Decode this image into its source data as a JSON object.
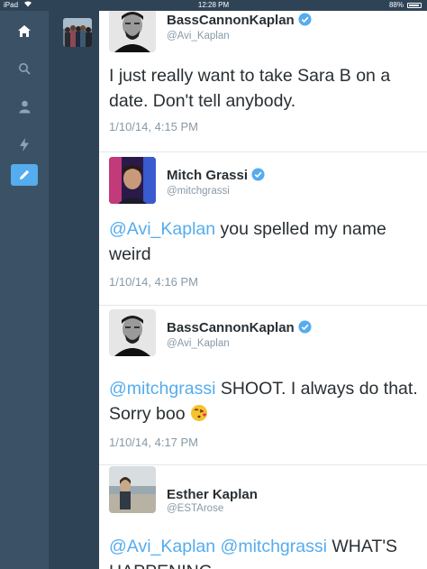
{
  "status_bar": {
    "carrier": "iPad",
    "time": "12:28 PM",
    "battery": "88%",
    "battery_level": 0.88
  },
  "nav": {
    "items": [
      {
        "icon": "home-icon",
        "active": false
      },
      {
        "icon": "search-icon",
        "active": false
      },
      {
        "icon": "profile-icon",
        "active": false
      },
      {
        "icon": "activity-icon",
        "active": false
      },
      {
        "icon": "compose-icon",
        "active": true
      }
    ]
  },
  "tweets": [
    {
      "name": "BassCannonKaplan",
      "handle": "@Avi_Kaplan",
      "verified": true,
      "text_segments": [
        {
          "text": "I just really want to take Sara B on a date. Don't tell anybody.",
          "mention": false
        }
      ],
      "timestamp": "1/10/14, 4:15 PM"
    },
    {
      "name": "Mitch Grassi",
      "handle": "@mitchgrassi",
      "verified": true,
      "text_segments": [
        {
          "text": "@Avi_Kaplan",
          "mention": true
        },
        {
          "text": " you spelled my name weird",
          "mention": false
        }
      ],
      "timestamp": "1/10/14, 4:16 PM"
    },
    {
      "name": "BassCannonKaplan",
      "handle": "@Avi_Kaplan",
      "verified": true,
      "text_segments": [
        {
          "text": "@mitchgrassi",
          "mention": true
        },
        {
          "text": " SHOOT. I always do that. Sorry boo ",
          "mention": false
        }
      ],
      "emoji": "kissing-face-emoji",
      "timestamp": "1/10/14, 4:17 PM"
    },
    {
      "name": "Esther Kaplan",
      "handle": "@ESTArose",
      "verified": false,
      "text_segments": [
        {
          "text": "@Avi_Kaplan",
          "mention": true
        },
        {
          "text": " ",
          "mention": false
        },
        {
          "text": "@mitchgrassi",
          "mention": true
        },
        {
          "text": " WHAT'S HAPPENING",
          "mention": false
        }
      ],
      "timestamp": ""
    }
  ],
  "colors": {
    "nav_bg": "#3b5266",
    "accent": "#55acee",
    "text": "#292f33",
    "muted": "#8899a6"
  }
}
